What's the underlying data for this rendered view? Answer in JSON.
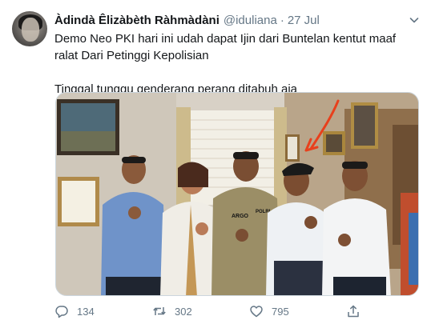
{
  "tweet": {
    "author_name": "Àdindà Êlizàbèth Ràhmàdàni",
    "handle": "@iduliana",
    "separator": "·",
    "timestamp": "27 Jul",
    "paragraphs": [
      "Demo Neo PKI hari ini udah dapat Ijin dari Buntelan kentut maaf ralat Dari Petinggi Kepolisian",
      "Tinggal tunggu genderang perang ditabuh aja"
    ],
    "photo_text": {
      "uniform_name": "ARGO",
      "uniform_badge": "POLRI"
    },
    "actions": {
      "reply_count": "134",
      "retweet_count": "302",
      "like_count": "795"
    }
  },
  "colors": {
    "text_primary": "#14171a",
    "text_secondary": "#657786",
    "arrow_annotation": "#e8401c"
  },
  "icons": [
    "chevron-down-icon",
    "reply-icon",
    "retweet-icon",
    "like-icon",
    "share-icon"
  ]
}
